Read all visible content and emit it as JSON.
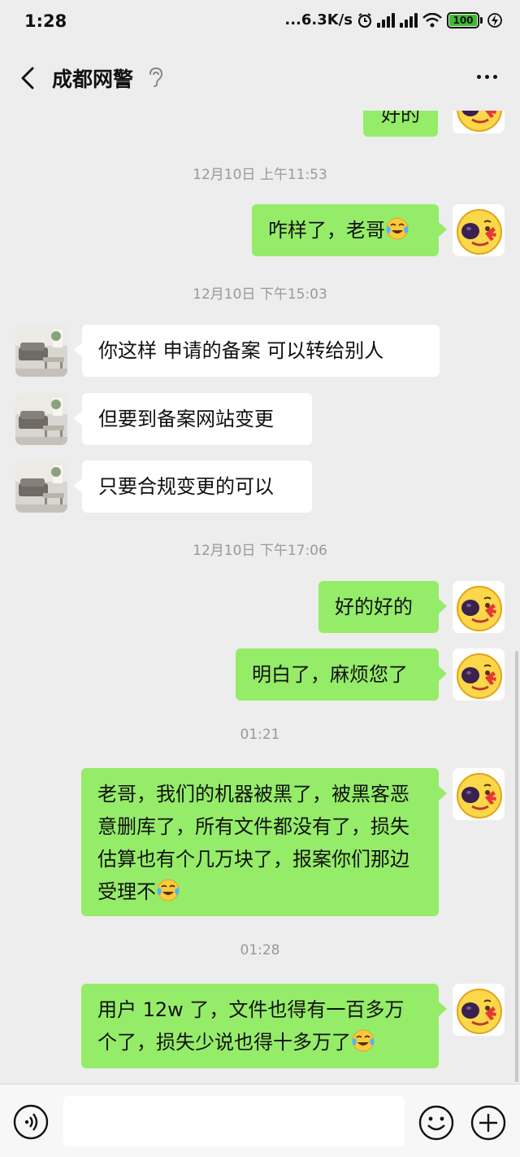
{
  "status_bar": {
    "time": "1:28",
    "network_speed": "...6.3K/s",
    "battery": "100"
  },
  "header": {
    "title": "成都网警"
  },
  "messages": [
    {
      "type": "text",
      "side": "out",
      "text": "好的"
    },
    {
      "type": "timestamp",
      "text": "12月10日 上午11:53"
    },
    {
      "type": "text",
      "side": "out",
      "text": "咋样了，老哥"
    },
    {
      "type": "timestamp",
      "text": "12月10日 下午15:03"
    },
    {
      "type": "text",
      "side": "in",
      "text": "你这样 申请的备案 可以转给别人"
    },
    {
      "type": "text",
      "side": "in",
      "text": "但要到备案网站变更"
    },
    {
      "type": "text",
      "side": "in",
      "text": "只要合规变更的可以"
    },
    {
      "type": "timestamp",
      "text": "12月10日 下午17:06"
    },
    {
      "type": "text",
      "side": "out",
      "text": "好的好的"
    },
    {
      "type": "text",
      "side": "out",
      "text": "明白了，麻烦您了"
    },
    {
      "type": "timestamp",
      "text": "01:21"
    },
    {
      "type": "text",
      "side": "out",
      "text": "老哥，我们的机器被黑了，被黑客恶意删库了，所有文件都没有了，损失估算也有个几万块了，报案你们那边受理不"
    },
    {
      "type": "timestamp",
      "text": "01:28"
    },
    {
      "type": "text",
      "side": "out",
      "text": "用户 12w 了，文件也得有一百多万个了，损失少说也得十多万了"
    }
  ],
  "icons": {
    "back": "chevron-left-icon",
    "ear": "ear-icon",
    "more": "more-dots-icon",
    "voice": "voice-icon",
    "emoji": "smiley-icon",
    "plus": "plus-icon",
    "crying_emoji": "tears-of-joy-emoji",
    "self_avatar": "smiley-face-avatar",
    "contact_avatar": "sofa-room-avatar"
  },
  "colors": {
    "outgoing_bubble": "#95ec69",
    "incoming_bubble": "#ffffff",
    "background": "#ededed"
  }
}
